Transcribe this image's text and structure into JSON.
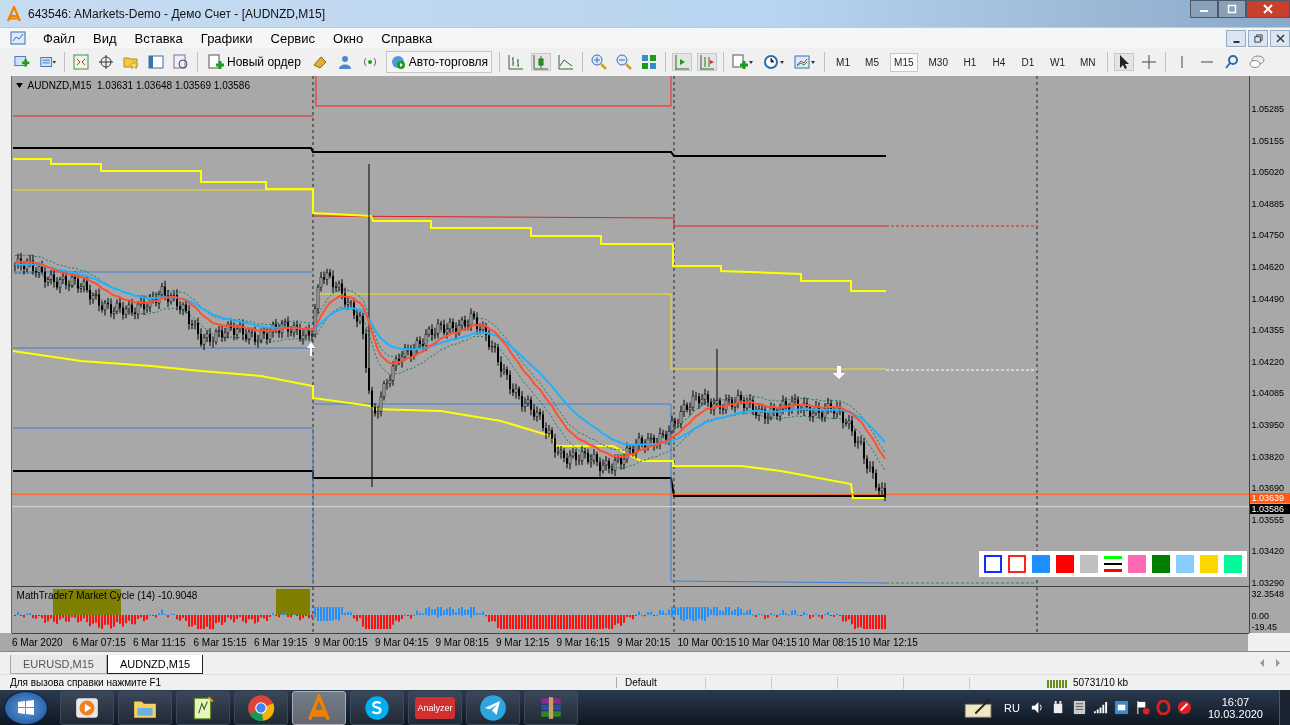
{
  "window": {
    "title": "643546: AMarkets-Demo - Демо Счет - [AUDNZD,M15]"
  },
  "menu": [
    "Файл",
    "Вид",
    "Вставка",
    "Графики",
    "Сервис",
    "Окно",
    "Справка"
  ],
  "toolbar": {
    "new_order": "Новый ордер",
    "auto_trading": "Авто-торговля",
    "timeframes": [
      {
        "label": "M1",
        "selected": false
      },
      {
        "label": "M5",
        "selected": false
      },
      {
        "label": "M15",
        "selected": true
      },
      {
        "label": "M30",
        "selected": false
      },
      {
        "label": "H1",
        "selected": false
      },
      {
        "label": "H4",
        "selected": false
      },
      {
        "label": "D1",
        "selected": false
      },
      {
        "label": "W1",
        "selected": false
      },
      {
        "label": "MN",
        "selected": false
      }
    ]
  },
  "chart": {
    "header": "AUDNZD,M15  1.03631 1.03648 1.03569 1.03586",
    "price_ticks": [
      "1.05285",
      "1.05155",
      "1.05020",
      "1.04885",
      "1.04750",
      "1.04620",
      "1.04490",
      "1.04355",
      "1.04220",
      "1.04085",
      "1.03950",
      "1.03820",
      "1.03690",
      "1.03555",
      "1.03420",
      "1.03290"
    ],
    "ask_label": "1.03639",
    "bid_label": "1.03586",
    "palette": [
      {
        "kind": "outline",
        "color": "#1030ff"
      },
      {
        "kind": "outline",
        "color": "#ff2020"
      },
      {
        "kind": "fill",
        "color": "#1e90ff"
      },
      {
        "kind": "fill",
        "color": "#ff0000"
      },
      {
        "kind": "fill",
        "color": "#c0c0c0"
      },
      {
        "kind": "lines",
        "color": "#00ff00"
      },
      {
        "kind": "fill",
        "color": "#ff69b4"
      },
      {
        "kind": "fill",
        "color": "#008000"
      },
      {
        "kind": "fill",
        "color": "#87cefa"
      },
      {
        "kind": "fill",
        "color": "#ffd700"
      },
      {
        "kind": "fill",
        "color": "#00fa9a"
      }
    ]
  },
  "indicator": {
    "label": "MathTrader7 Market Cycle (14) -10.9048",
    "scale": [
      "32.3548",
      "0.00",
      "-19.45"
    ]
  },
  "time_axis": [
    "6 Mar 2020",
    "6 Mar 07:15",
    "6 Mar 11:15",
    "6 Mar 15:15",
    "6 Mar 19:15",
    "9 Mar 00:15",
    "9 Mar 04:15",
    "9 Mar 08:15",
    "9 Mar 12:15",
    "9 Mar 16:15",
    "9 Mar 20:15",
    "10 Mar 00:15",
    "10 Mar 04:15",
    "10 Mar 08:15",
    "10 Mar 12:15"
  ],
  "chart_tabs": [
    {
      "label": "EURUSD,M15",
      "selected": false
    },
    {
      "label": "AUDNZD,M15",
      "selected": true
    }
  ],
  "status_bar": {
    "help": "Для вызова справки нажмите F1",
    "profile": "Default",
    "traffic": "50731/10 kb"
  },
  "taskbar": {
    "apps": [
      {
        "kind": "player",
        "selected": false
      },
      {
        "kind": "folder",
        "selected": false
      },
      {
        "kind": "notepad",
        "selected": false
      },
      {
        "kind": "chrome",
        "selected": false
      },
      {
        "kind": "amarkets",
        "selected": true
      },
      {
        "kind": "skype",
        "selected": false
      },
      {
        "kind": "analyzer",
        "label": "Analyzer",
        "selected": false
      },
      {
        "kind": "telegram",
        "selected": false
      },
      {
        "kind": "winrar",
        "selected": false
      }
    ],
    "language": "RU",
    "time": "16:07",
    "date": "10.03.2020"
  }
}
